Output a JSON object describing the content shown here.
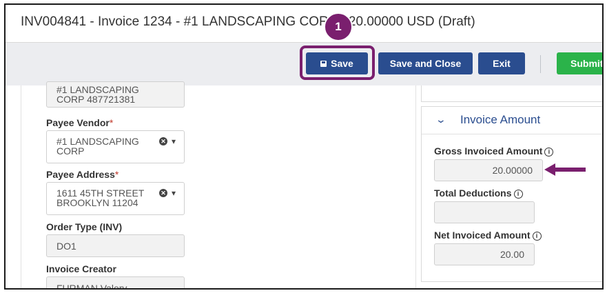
{
  "window": {
    "title": "INV004841 - Invoice 1234 - #1 LANDSCAPING CORP - 20.00000 USD (Draft)"
  },
  "step_badge": "1",
  "toolbar": {
    "save_label": "Save",
    "save_close_label": "Save and Close",
    "exit_label": "Exit",
    "submit_label": "Submit"
  },
  "form": {
    "top_field_value": "#1 LANDSCAPING CORP 487721381",
    "payee_vendor": {
      "label": "Payee Vendor",
      "required": "*",
      "value": "#1 LANDSCAPING CORP"
    },
    "payee_address": {
      "label": "Payee Address",
      "required": "*",
      "value": "1611 45TH STREET BROOKLYN 11204"
    },
    "order_type": {
      "label": "Order Type (INV)",
      "value": "DO1"
    },
    "invoice_creator": {
      "label": "Invoice Creator",
      "value": "FURMAN Valery"
    }
  },
  "invoice_amount": {
    "section_title": "Invoice Amount",
    "gross_label": "Gross Invoiced Amount",
    "gross_value": "20.00000",
    "deductions_label": "Total Deductions",
    "deductions_value": "",
    "net_label": "Net Invoiced Amount",
    "net_value": "20.00"
  },
  "icons": {
    "info": "i",
    "clear": "✕",
    "dropdown": "▾",
    "collapse": "⌄"
  },
  "colors": {
    "primary_button": "#2a4d8f",
    "submit_button": "#2bb34a",
    "highlight": "#7a1f6e",
    "required": "#c0392b"
  }
}
